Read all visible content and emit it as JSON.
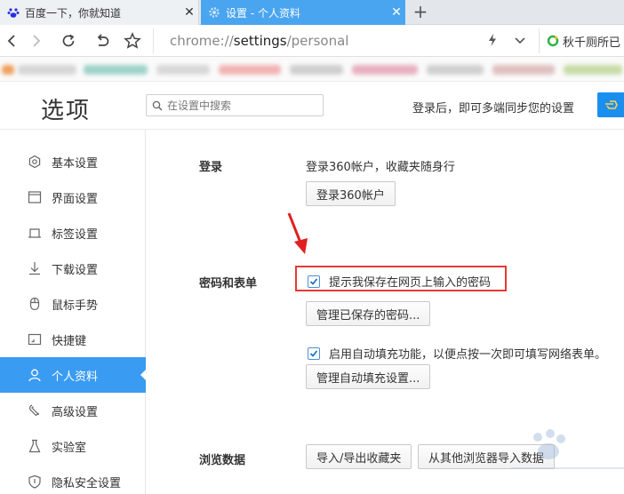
{
  "tabs": [
    {
      "title": "百度一下，你就知道",
      "icon": "baidu-paw-icon",
      "active": false
    },
    {
      "title": "设置 - 个人资料",
      "icon": "gear-icon",
      "active": true
    }
  ],
  "new_tab_symbol": "+",
  "close_symbol": "✕",
  "address": {
    "prefix": "chrome://",
    "highlight": "settings",
    "suffix": "/personal"
  },
  "extension_text": "秋千厕所已",
  "header": {
    "title": "选项",
    "search_placeholder": "在设置中搜索",
    "sync_text": "登录后，即可多端同步您的设置"
  },
  "sidebar": {
    "items": [
      {
        "label": "基本设置",
        "icon": "settings-outline-icon"
      },
      {
        "label": "界面设置",
        "icon": "window-icon"
      },
      {
        "label": "标签设置",
        "icon": "tab-icon"
      },
      {
        "label": "下载设置",
        "icon": "download-icon"
      },
      {
        "label": "鼠标手势",
        "icon": "mouse-icon"
      },
      {
        "label": "快捷键",
        "icon": "keyboard-icon"
      },
      {
        "label": "个人资料",
        "icon": "user-icon",
        "active": true
      },
      {
        "label": "高级设置",
        "icon": "wrench-icon"
      },
      {
        "label": "实验室",
        "icon": "flask-icon"
      },
      {
        "label": "隐私安全设置",
        "icon": "shield-icon"
      }
    ]
  },
  "login": {
    "label": "登录",
    "description": "登录360帐户，收藏夹随身行",
    "button": "登录360帐户"
  },
  "passwords": {
    "label": "密码和表单",
    "save_password_checkbox": "提示我保存在网页上输入的密码",
    "manage_passwords_button": "管理已保存的密码...",
    "autofill_checkbox": "启用自动填充功能，以便点按一次即可填写网络表单。",
    "manage_autofill_button": "管理自动填充设置..."
  },
  "browsing_data": {
    "label": "浏览数据",
    "import_export_button": "导入/导出收藏夹",
    "import_other_button": "从其他浏览器导入数据"
  },
  "colors": {
    "accent": "#3a9bf2",
    "highlight_border": "#e53935",
    "arrow": "#e02020"
  }
}
